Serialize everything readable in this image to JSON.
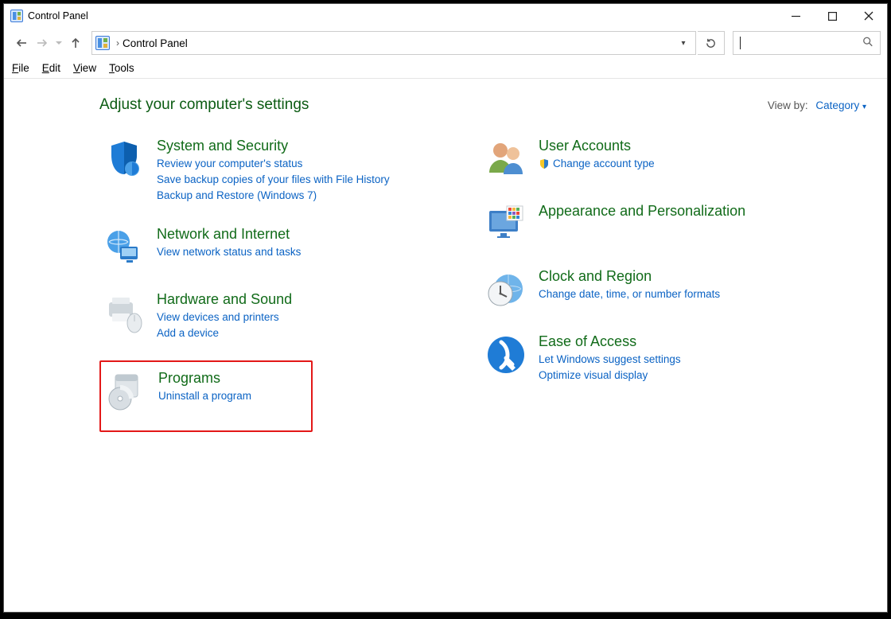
{
  "window_title": "Control Panel",
  "breadcrumb": "Control Panel",
  "menu": {
    "file": "File",
    "edit": "Edit",
    "view": "View",
    "tools": "Tools"
  },
  "heading": "Adjust your computer's settings",
  "viewby_label": "View by:",
  "viewby_value": "Category",
  "left_categories": [
    {
      "title": "System and Security",
      "links": [
        "Review your computer's status",
        "Save backup copies of your files with File History",
        "Backup and Restore (Windows 7)"
      ]
    },
    {
      "title": "Network and Internet",
      "links": [
        "View network status and tasks"
      ]
    },
    {
      "title": "Hardware and Sound",
      "links": [
        "View devices and printers",
        "Add a device"
      ]
    },
    {
      "title": "Programs",
      "links": [
        "Uninstall a program"
      ]
    }
  ],
  "right_categories": [
    {
      "title": "User Accounts",
      "links": [
        "Change account type"
      ],
      "shield": true
    },
    {
      "title": "Appearance and Personalization",
      "links": []
    },
    {
      "title": "Clock and Region",
      "links": [
        "Change date, time, or number formats"
      ]
    },
    {
      "title": "Ease of Access",
      "links": [
        "Let Windows suggest settings",
        "Optimize visual display"
      ]
    }
  ]
}
